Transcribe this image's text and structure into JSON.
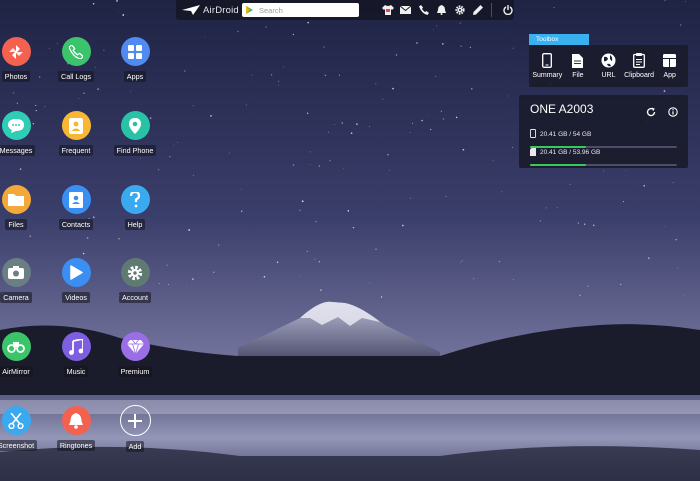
{
  "topbar": {
    "brand": "AirDroid",
    "search_placeholder": "Search",
    "icons": [
      "theme-shirt-icon",
      "message-icon",
      "phone-icon",
      "notification-bell-icon",
      "settings-gear-icon",
      "edit-pen-icon",
      "power-icon"
    ]
  },
  "apps": [
    {
      "label": "Photos",
      "color": "#f4624f",
      "icon": "photos-icon"
    },
    {
      "label": "Call Logs",
      "color": "#3bc46b",
      "icon": "phone-icon"
    },
    {
      "label": "Apps",
      "color": "#4f8bf1",
      "icon": "grid-icon"
    },
    {
      "label": "Messages",
      "color": "#2fcdb6",
      "icon": "chat-icon"
    },
    {
      "label": "Frequent",
      "color": "#f7b733",
      "icon": "contact-card-icon"
    },
    {
      "label": "Find Phone",
      "color": "#28c2a6",
      "icon": "location-pin-icon"
    },
    {
      "label": "Files",
      "color": "#f3a83a",
      "icon": "folder-icon"
    },
    {
      "label": "Contacts",
      "color": "#3a8ff2",
      "icon": "contact-book-icon"
    },
    {
      "label": "Help",
      "color": "#3aa9f0",
      "icon": "question-icon"
    },
    {
      "label": "Camera",
      "color": "#6a7f84",
      "icon": "camera-icon"
    },
    {
      "label": "Videos",
      "color": "#3b8ef2",
      "icon": "play-icon"
    },
    {
      "label": "Account",
      "color": "#5f7a73",
      "icon": "gear-icon"
    },
    {
      "label": "AirMirror",
      "color": "#3cc46b",
      "icon": "binoculars-icon"
    },
    {
      "label": "Music",
      "color": "#7e5fe0",
      "icon": "music-note-icon"
    },
    {
      "label": "Premium",
      "color": "#9a6ee6",
      "icon": "diamond-icon"
    },
    {
      "label": "Screenshot",
      "color": "#3aa9f0",
      "icon": "scissors-icon"
    },
    {
      "label": "Ringtones",
      "color": "#f4624f",
      "icon": "bell-icon"
    },
    {
      "label": "Add",
      "color": "#ffffff",
      "icon": "plus-icon"
    }
  ],
  "toolbox": {
    "tab_label": "Toolbox",
    "items": [
      {
        "label": "Summary",
        "icon": "phone-outline-icon"
      },
      {
        "label": "File",
        "icon": "file-icon"
      },
      {
        "label": "URL",
        "icon": "globe-icon"
      },
      {
        "label": "Clipboard",
        "icon": "clipboard-icon"
      },
      {
        "label": "App",
        "icon": "app-window-icon"
      }
    ]
  },
  "device": {
    "name": "ONE A2003",
    "storage": [
      {
        "text": "20.41 GB / 54 GB",
        "fraction": 0.378,
        "icon": "phone-storage-icon"
      },
      {
        "text": "20.41 GB / 53.96 GB",
        "fraction": 0.378,
        "icon": "sd-card-icon"
      }
    ],
    "bar_color": "#39c85a"
  }
}
